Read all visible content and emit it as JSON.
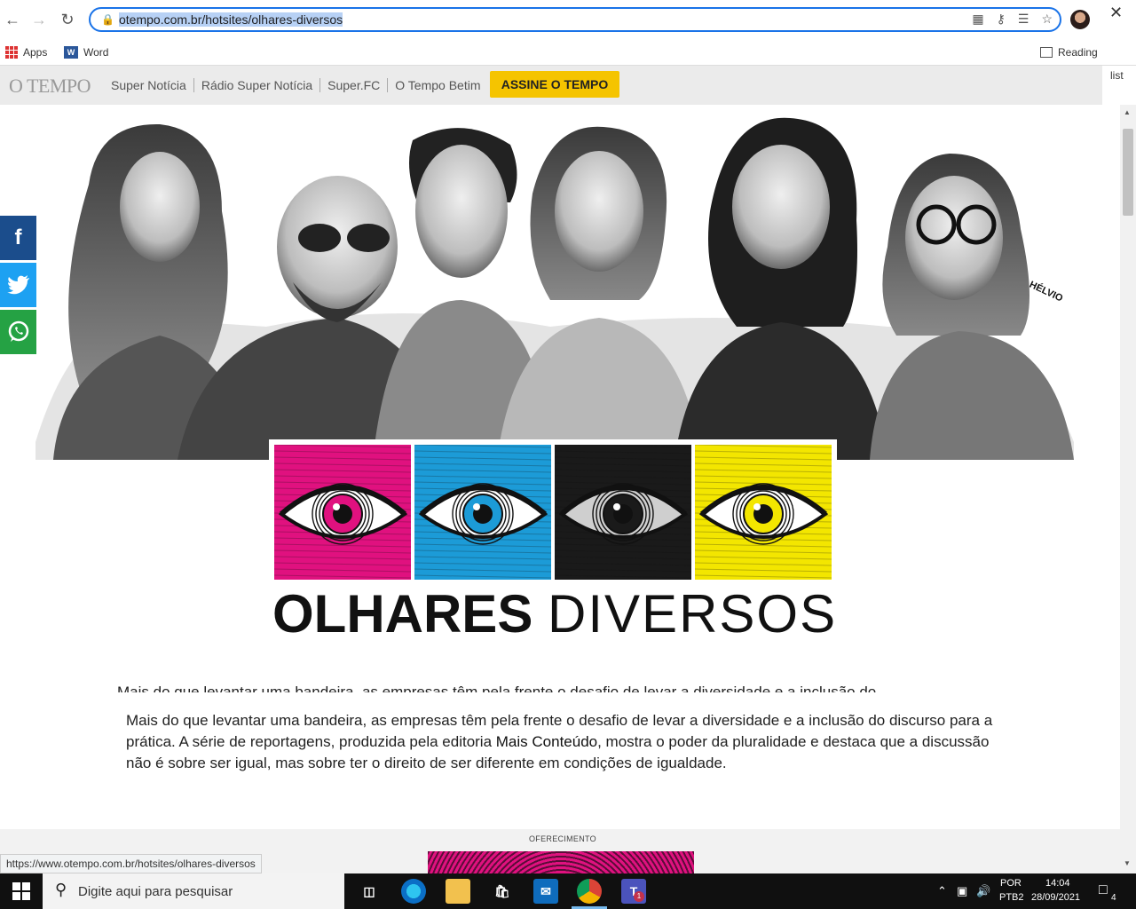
{
  "browser": {
    "url_display": "otempo.com.br/hotsites/olhares-diversos",
    "bookmarks": [
      {
        "label": "Apps",
        "icon": "apps-grid-icon"
      },
      {
        "label": "Word",
        "icon": "word-icon"
      }
    ],
    "reading_list_label": "Reading",
    "reading_list_tail": "list",
    "status_url": "https://www.otempo.com.br/hotsites/olhares-diversos"
  },
  "site": {
    "logo": "O TEMPO",
    "nav": [
      "Super Notícia",
      "Rádio Super Notícia",
      "Super.FC",
      "O Tempo Betim"
    ],
    "cta": "ASSINE O TEMPO",
    "signature": "HÉLVIO",
    "brand_bold": "OLHARES",
    "brand_thin": "DIVERSOS",
    "sticky_line": "Mais do que levantar uma bandeira, as empresas têm pela frente o desafio de levar a diversidade e a inclusão do",
    "intro_1": "Mais do que levantar uma bandeira, as empresas têm pela frente o desafio de levar a diversidade e a inclusão do discurso para a prática. A série de reportagens, produzida pela editoria ",
    "intro_link": "Mais Conteúdo",
    "intro_2": ", mostra o poder da pluralidade e destaca que a discussão não é sobre ser igual, mas sobre ter o direito de ser diferente em condições de igualdade.",
    "sponsor_label": "OFERECIMENTO",
    "eye_colors": [
      "#e0117f",
      "#1c9bd7",
      "#1a1a1a",
      "#f3e600"
    ]
  },
  "social": {
    "facebook": "f",
    "twitter": "twitter-bird-icon",
    "whatsapp": "whatsapp-icon"
  },
  "taskbar": {
    "search_placeholder": "Digite aqui para pesquisar",
    "lang_1": "POR",
    "lang_2": "PTB2",
    "time": "14:04",
    "date": "28/09/2021",
    "notifications": "4",
    "teams_badge": "1"
  }
}
